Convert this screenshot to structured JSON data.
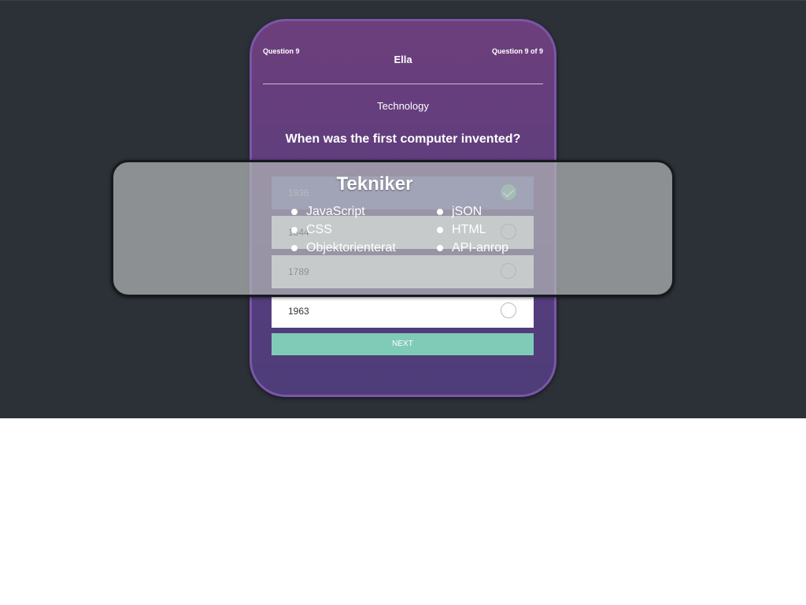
{
  "quiz": {
    "question_label": "Question 9",
    "user_name": "Ella",
    "progress_label": "Question 9 of 9",
    "category": "Technology",
    "question": "When was the first computer invented?",
    "options": [
      {
        "label": "1936",
        "selected": true
      },
      {
        "label": "1844",
        "selected": false
      },
      {
        "label": "1789",
        "selected": false
      },
      {
        "label": "1963",
        "selected": false
      }
    ],
    "next_label": "NEXT"
  },
  "overlay": {
    "title": "Tekniker",
    "left_column": [
      "JavaScript",
      "CSS",
      "Objektorienterat"
    ],
    "right_column": [
      "jSON",
      "HTML",
      "API-anrop"
    ]
  },
  "colors": {
    "background": "#2c3138",
    "phone_gradient_top": "#6d3f7c",
    "phone_gradient_bottom": "#4d3d79",
    "selected_option": "#7873b6",
    "accent": "#7fcbb8"
  }
}
